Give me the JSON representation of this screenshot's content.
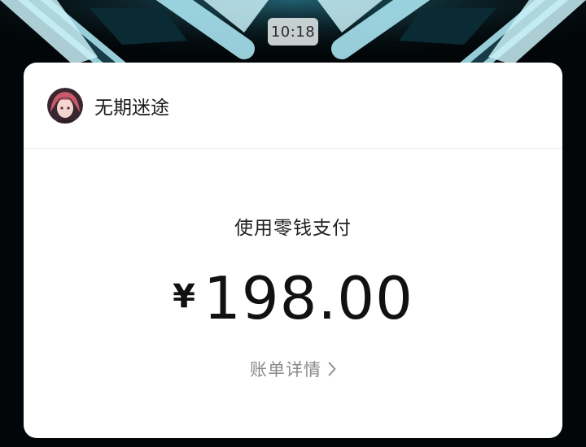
{
  "timestamp": "10:18",
  "sender": {
    "name": "无期迷途",
    "avatar_icon": "anime-avatar-icon"
  },
  "payment": {
    "method": "使用零钱支付",
    "currency_symbol": "¥",
    "amount": "198.00",
    "details_link": "账单详情",
    "details_icon": "chevron-right-icon"
  },
  "colors": {
    "card_bg": "#ffffff",
    "page_bg": "#000000",
    "wallpaper_accent": "#8fd6e6",
    "link_gray": "#8a8a8a"
  }
}
